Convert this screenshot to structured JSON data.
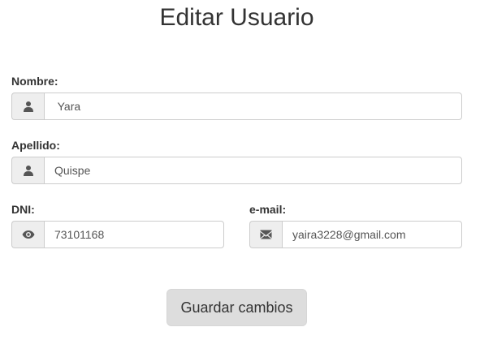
{
  "title": "Editar Usuario",
  "form": {
    "nombre": {
      "label": "Nombre:",
      "value": " Yara",
      "icon": "user-icon"
    },
    "apellido": {
      "label": "Apellido:",
      "value": "Quispe",
      "icon": "user-icon"
    },
    "dni": {
      "label": "DNI:",
      "value": "73101168",
      "icon": "eye-icon"
    },
    "email": {
      "label": "e-mail:",
      "value": "yaira3228@gmail.com",
      "icon": "envelope-icon"
    },
    "submit_label": "Guardar cambios"
  },
  "colors": {
    "addon_background": "#eeeeee",
    "border": "#cccccc",
    "button_background": "#dddddd",
    "text": "#333333"
  }
}
